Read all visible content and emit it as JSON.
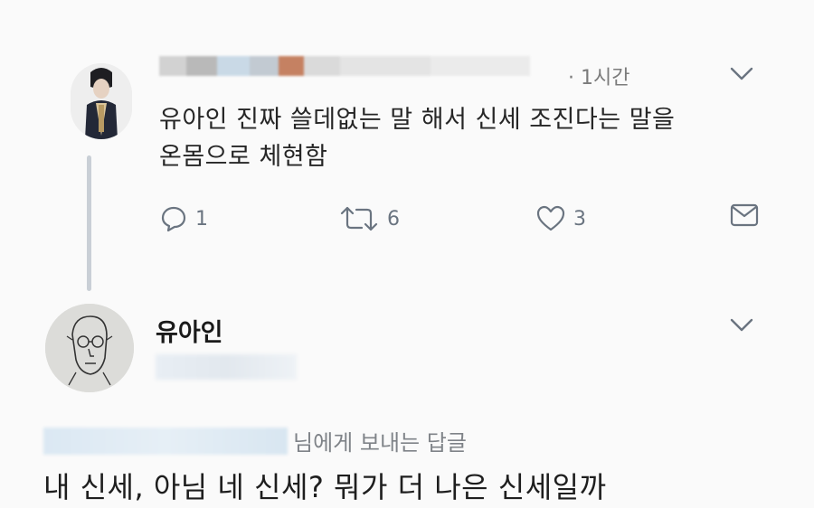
{
  "tweet": {
    "time": "· 1시간",
    "text_lines": [
      "유아인 진짜 쓸데없는 말 해서 신세 조진다는 말을",
      "온몸으로 체현함"
    ],
    "actions": {
      "reply_count": "1",
      "retweet_count": "6",
      "like_count": "3"
    }
  },
  "reply": {
    "author": "유아인",
    "replying_to": "님에게 보내는 답글",
    "text": "내 신세, 아님 네 신세? 뭐가 더 나은 신세일까"
  },
  "icons": [
    "profile-avatar",
    "chevron-down-icon",
    "reply-icon",
    "retweet-icon",
    "heart-icon",
    "mail-icon"
  ],
  "colors": {
    "icon": "#6a7480",
    "thread_line": "#c9cfd6",
    "background": "#fafafa"
  }
}
